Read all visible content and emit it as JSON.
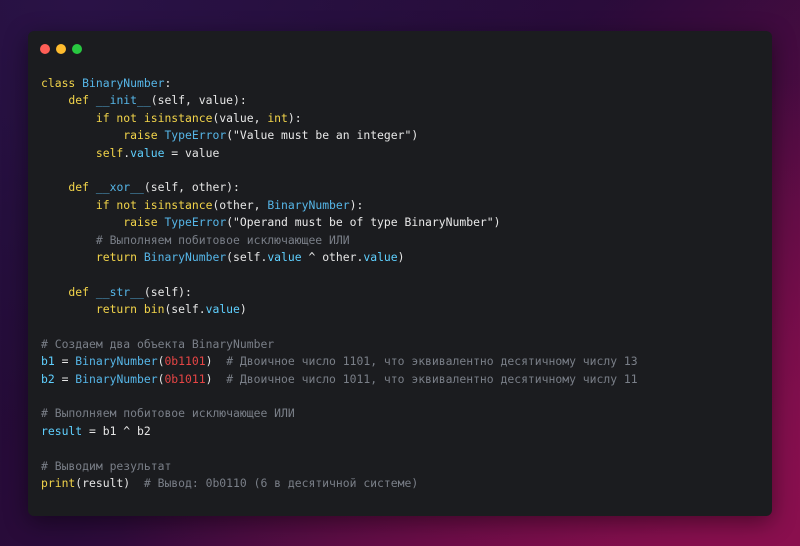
{
  "window": {
    "controls": [
      "close",
      "minimize",
      "maximize"
    ]
  },
  "code": {
    "lines": [
      [
        {
          "t": "class ",
          "c": "kw"
        },
        {
          "t": "BinaryNumber",
          "c": "ty"
        },
        {
          "t": ":",
          "c": "op"
        }
      ],
      [
        {
          "t": "    def ",
          "c": "kw"
        },
        {
          "t": "__init__",
          "c": "ty"
        },
        {
          "t": "(self, value):",
          "c": "op"
        }
      ],
      [
        {
          "t": "        if not ",
          "c": "kw"
        },
        {
          "t": "isinstance",
          "c": "fn"
        },
        {
          "t": "(value, ",
          "c": "op"
        },
        {
          "t": "int",
          "c": "fn"
        },
        {
          "t": "):",
          "c": "op"
        }
      ],
      [
        {
          "t": "            raise ",
          "c": "kw"
        },
        {
          "t": "TypeError",
          "c": "ty"
        },
        {
          "t": "(\"Value must be an integer\")",
          "c": "str"
        }
      ],
      [
        {
          "t": "        self",
          "c": "fn"
        },
        {
          "t": ".",
          "c": "op"
        },
        {
          "t": "value",
          "c": "var"
        },
        {
          "t": " = value",
          "c": "op"
        }
      ],
      [],
      [
        {
          "t": "    def ",
          "c": "kw"
        },
        {
          "t": "__xor__",
          "c": "ty"
        },
        {
          "t": "(self, other):",
          "c": "op"
        }
      ],
      [
        {
          "t": "        if not ",
          "c": "kw"
        },
        {
          "t": "isinstance",
          "c": "fn"
        },
        {
          "t": "(other, ",
          "c": "op"
        },
        {
          "t": "BinaryNumber",
          "c": "ty"
        },
        {
          "t": "):",
          "c": "op"
        }
      ],
      [
        {
          "t": "            raise ",
          "c": "kw"
        },
        {
          "t": "TypeError",
          "c": "ty"
        },
        {
          "t": "(\"Operand must be of type BinaryNumber\")",
          "c": "str"
        }
      ],
      [
        {
          "t": "        # Выполняем побитовое исключающее ИЛИ",
          "c": "cm"
        }
      ],
      [
        {
          "t": "        return ",
          "c": "kw"
        },
        {
          "t": "BinaryNumber",
          "c": "ty"
        },
        {
          "t": "(self.",
          "c": "op"
        },
        {
          "t": "value",
          "c": "var"
        },
        {
          "t": " ^ other.",
          "c": "op"
        },
        {
          "t": "value",
          "c": "var"
        },
        {
          "t": ")",
          "c": "op"
        }
      ],
      [],
      [
        {
          "t": "    def ",
          "c": "kw"
        },
        {
          "t": "__str__",
          "c": "ty"
        },
        {
          "t": "(self):",
          "c": "op"
        }
      ],
      [
        {
          "t": "        return ",
          "c": "kw"
        },
        {
          "t": "bin",
          "c": "fn"
        },
        {
          "t": "(self.",
          "c": "op"
        },
        {
          "t": "value",
          "c": "var"
        },
        {
          "t": ")",
          "c": "op"
        }
      ],
      [],
      [
        {
          "t": "# Создаем два объекта BinaryNumber",
          "c": "cm"
        }
      ],
      [
        {
          "t": "b1",
          "c": "var"
        },
        {
          "t": " = ",
          "c": "op"
        },
        {
          "t": "BinaryNumber",
          "c": "ty"
        },
        {
          "t": "(",
          "c": "op"
        },
        {
          "t": "0b1101",
          "c": "num"
        },
        {
          "t": ")  ",
          "c": "op"
        },
        {
          "t": "# Двоичное число 1101, что эквивалентно десятичному числу 13",
          "c": "cm"
        }
      ],
      [
        {
          "t": "b2",
          "c": "var"
        },
        {
          "t": " = ",
          "c": "op"
        },
        {
          "t": "BinaryNumber",
          "c": "ty"
        },
        {
          "t": "(",
          "c": "op"
        },
        {
          "t": "0b1011",
          "c": "num"
        },
        {
          "t": ")  ",
          "c": "op"
        },
        {
          "t": "# Двоичное число 1011, что эквивалентно десятичному числу 11",
          "c": "cm"
        }
      ],
      [],
      [
        {
          "t": "# Выполняем побитовое исключающее ИЛИ",
          "c": "cm"
        }
      ],
      [
        {
          "t": "result",
          "c": "var"
        },
        {
          "t": " = b1 ^ b2",
          "c": "op"
        }
      ],
      [],
      [
        {
          "t": "# Выводим результат",
          "c": "cm"
        }
      ],
      [
        {
          "t": "print",
          "c": "fn"
        },
        {
          "t": "(result)  ",
          "c": "op"
        },
        {
          "t": "# Вывод: 0b0110 (6 в десятичной системе)",
          "c": "cm"
        }
      ]
    ]
  }
}
